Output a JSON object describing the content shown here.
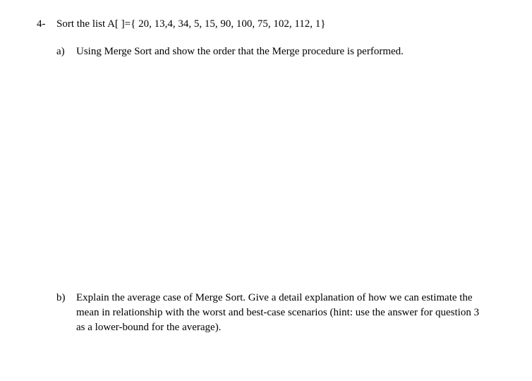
{
  "question": {
    "number": "4-",
    "text": "Sort the list A[ ]={ 20, 13,4, 34, 5, 15, 90, 100, 75, 102, 112, 1}"
  },
  "subA": {
    "label": "a)",
    "text": "Using Merge Sort and show the order that the Merge procedure is performed."
  },
  "subB": {
    "label": "b)",
    "text": "Explain the average case of Merge Sort. Give a detail explanation of how we can estimate the mean in relationship with the worst and best-case scenarios (hint: use the answer for question 3 as a lower-bound for the average)."
  }
}
